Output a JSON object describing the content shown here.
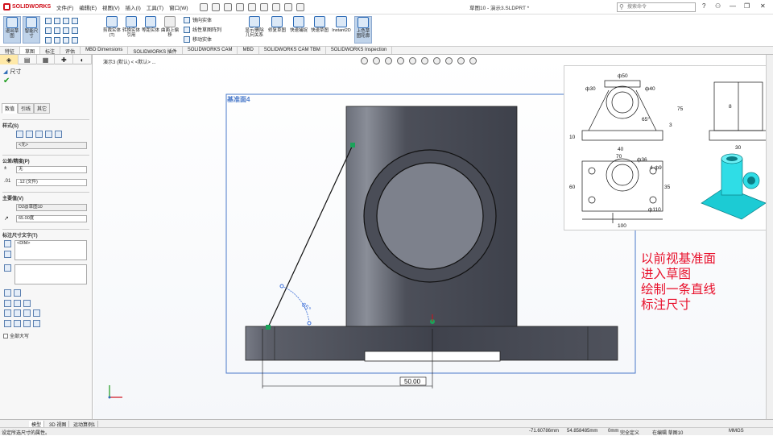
{
  "app": {
    "brand": "SOLIDWORKS",
    "doc_title": "草图10 - 演示3.SLDPRT *",
    "search_placeholder": "搜索命令"
  },
  "menu": [
    "文件(F)",
    "编辑(E)",
    "视图(V)",
    "插入(I)",
    "工具(T)",
    "窗口(W)"
  ],
  "ribbon": {
    "exit_sketch": "退出草图",
    "smart_dim": "智能尺寸",
    "trim": "剪裁实体(T)",
    "convert": "转换实体引用",
    "offset": "等距实体",
    "surface": "曲面上偏移",
    "mirror": "镜向实体",
    "linear_pattern": "线性草图阵列",
    "move": "移动实体",
    "display_delete": "显示/删除几何关系",
    "repair": "修复草图",
    "quick_snap": "快速捕捉",
    "rapid_sketch": "快速草图",
    "instant2d": "Instant2D",
    "shaded": "上色草图轮廓"
  },
  "tabs": [
    "特征",
    "草图",
    "标注",
    "评估",
    "MBD Dimensions",
    "SOLIDWORKS 插件",
    "SOLIDWORKS CAM",
    "MBD",
    "SOLIDWORKS CAM TBM",
    "SOLIDWORKS Inspection"
  ],
  "breadcrumb": "演示3 (默认) < <默认> ...",
  "left_panel": {
    "title": "尺寸",
    "subtabs": [
      "数值",
      "引线",
      "其它"
    ],
    "style_label": "样式(S)",
    "style_value": "<无>",
    "tolerance_label": "公差/精度(P)",
    "tolerance_value": "无",
    "precision_value": ".12 (文件)",
    "primary_label": "主要值(V)",
    "primary_name": "D2@草图10",
    "primary_value": "65.00度",
    "dimtext_label": "标注尺寸文字(T)",
    "dimtext_value": "<DIM>",
    "checkbox_label": "全部大写"
  },
  "canvas": {
    "plane_label": "基准面4",
    "dim_value": "50.00",
    "angle_value": "65°",
    "annotation": [
      "以前视基准面",
      "进入草图",
      "绘制一条直线",
      "标注尺寸"
    ]
  },
  "ref_drawing": {
    "labels": [
      "ф50",
      "ф30",
      "ф40",
      "65°",
      "75",
      "10",
      "40",
      "8",
      "30",
      "3",
      "70",
      "ф36",
      "4-ф9",
      "60",
      "35",
      "ф110",
      "100"
    ]
  },
  "bottom_tabs": [
    "模型",
    "3D 视图",
    "运动算例1"
  ],
  "status": {
    "hint": "设定所选尺寸的属性。",
    "x": "-71.60786mm",
    "y": "54.858485mm",
    "z": "0mm",
    "state": "完全定义",
    "mode": "在编辑 草图10",
    "units": "MMGS"
  },
  "colors": {
    "accent": "#2d6bb6",
    "body": "#4a4d57",
    "annotation": "#e8102b",
    "plane": "#4a79c9"
  }
}
